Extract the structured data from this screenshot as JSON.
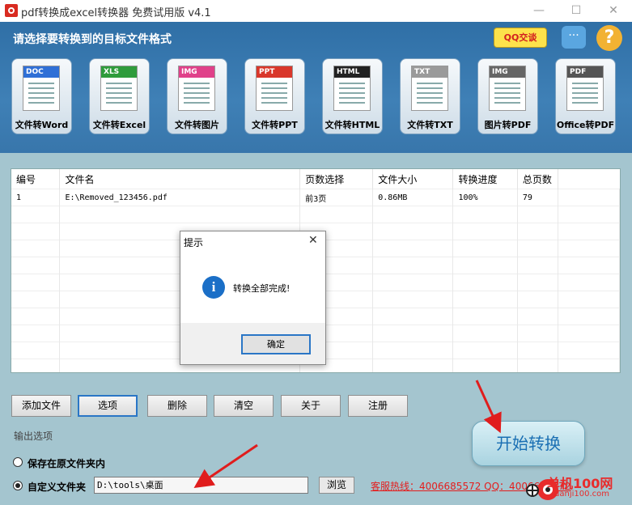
{
  "window": {
    "title": "pdf转换成excel转换器 免费试用版 v4.1",
    "minimize_glyph": "—",
    "maximize_glyph": "☐",
    "close_glyph": "✕"
  },
  "header": {
    "title": "请选择要转换到的目标文件格式",
    "qq_label": "QQ交谈",
    "chat_glyph": "···",
    "help_glyph": "?"
  },
  "converters": [
    {
      "badge": "DOC",
      "label": "文件转Word",
      "color": "#2f6fd6"
    },
    {
      "badge": "XLS",
      "label": "文件转Excel",
      "color": "#2f9c3c"
    },
    {
      "badge": "IMG",
      "label": "文件转图片",
      "color": "#e0418a"
    },
    {
      "badge": "PPT",
      "label": "文件转PPT",
      "color": "#d9372b"
    },
    {
      "badge": "HTML",
      "label": "文件转HTML",
      "color": "#222222"
    },
    {
      "badge": "TXT",
      "label": "文件转TXT",
      "color": "#9a9a9a"
    },
    {
      "badge": "IMG",
      "label": "图片转PDF",
      "color": "#666666"
    },
    {
      "badge": "PDF",
      "label": "Office转PDF",
      "color": "#555555"
    }
  ],
  "table": {
    "columns": [
      "编号",
      "文件名",
      "页数选择",
      "文件大小",
      "转换进度",
      "总页数"
    ],
    "rows": [
      [
        "1",
        "E:\\Removed_123456.pdf",
        "前3页",
        "0.86MB",
        "100%",
        "79"
      ]
    ]
  },
  "dialog": {
    "title": "提示",
    "close_glyph": "✕",
    "icon_glyph": "i",
    "message": "转换全部完成!",
    "ok_label": "确定"
  },
  "buttons": {
    "add_file": "添加文件",
    "options": "选项",
    "delete": "删除",
    "clear": "清空",
    "about": "关于",
    "register": "注册",
    "start": "开始转换"
  },
  "output": {
    "section_label": "输出选项",
    "option_original": "保存在原文件夹内",
    "option_custom": "自定义文件夹",
    "path_value": "D:\\tools\\桌面",
    "browse_label": "浏览",
    "selected": "custom"
  },
  "hotline": "客服热线：4006685572 QQ：4006685572",
  "watermark": {
    "text": "单机100网",
    "sub": "danji100.com"
  }
}
